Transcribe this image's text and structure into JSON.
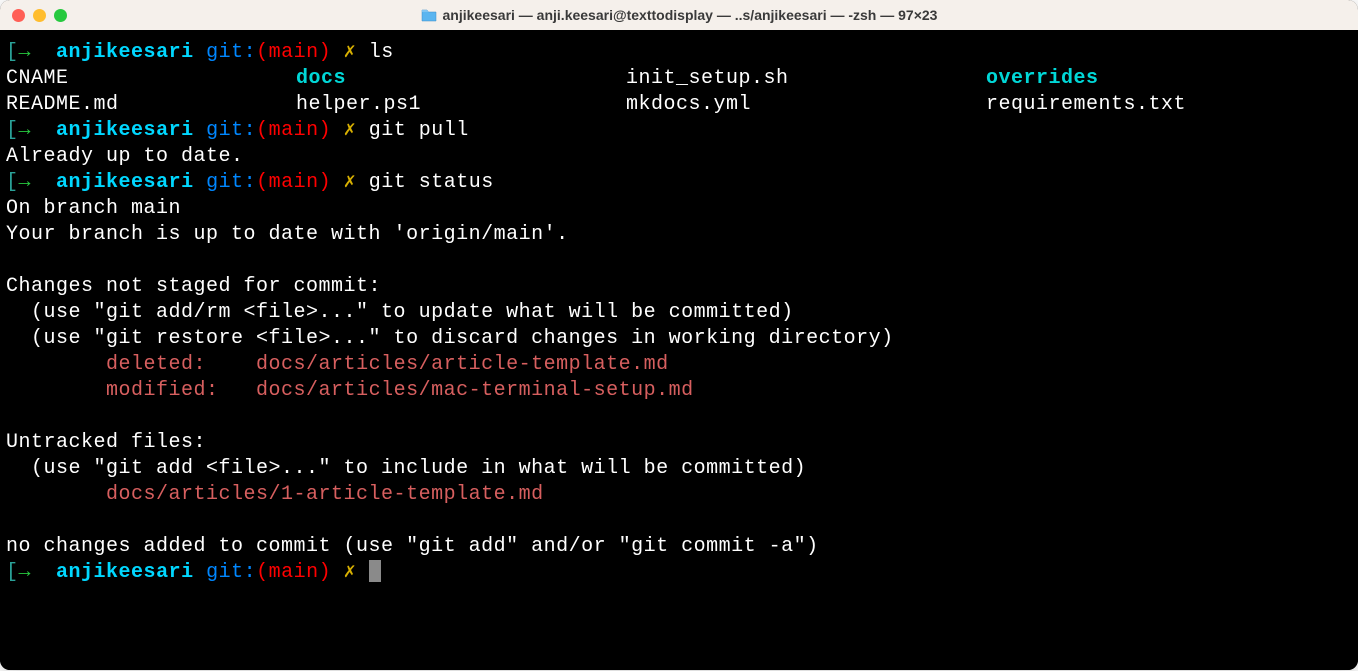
{
  "window": {
    "title": "anjikeesari — anji.keesari@texttodisplay — ..s/anjikeesari — -zsh — 97×23"
  },
  "prompt": {
    "bracket_open": "[",
    "arrow": "→",
    "dir": "anjikeesari",
    "git": "git:",
    "paren_open": "(",
    "branch": "main",
    "paren_close": ")",
    "x": "✗"
  },
  "cmd1": "ls",
  "ls": {
    "r1c1": "CNAME",
    "r1c2": "docs",
    "r1c3": "init_setup.sh",
    "r1c4": "overrides",
    "r2c1": "README.md",
    "r2c2": "helper.ps1",
    "r2c3": "mkdocs.yml",
    "r2c4": "requirements.txt"
  },
  "cmd2": "git pull",
  "pull_out": "Already up to date.",
  "cmd3": "git status",
  "status": {
    "l1": "On branch main",
    "l2": "Your branch is up to date with 'origin/main'.",
    "l3": "Changes not staged for commit:",
    "l4": "  (use \"git add/rm <file>...\" to update what will be committed)",
    "l5": "  (use \"git restore <file>...\" to discard changes in working directory)",
    "deleted_label": "        deleted:    ",
    "deleted_file": "docs/articles/article-template.md",
    "modified_label": "        modified:   ",
    "modified_file": "docs/articles/mac-terminal-setup.md",
    "l6": "Untracked files:",
    "l7": "  (use \"git add <file>...\" to include in what will be committed)",
    "untracked_indent": "        ",
    "untracked_file": "docs/articles/1-article-template.md",
    "l8": "no changes added to commit (use \"git add\" and/or \"git commit -a\")"
  }
}
